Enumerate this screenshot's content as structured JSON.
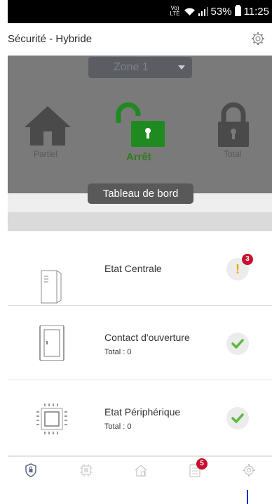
{
  "status_bar": {
    "network": "VoLTE",
    "battery": "53%",
    "time": "11:25",
    "icons": [
      "volte-icon",
      "wifi-icon",
      "signal-icon",
      "battery-icon"
    ]
  },
  "header": {
    "title": "Sécurité - Hybride",
    "settings_icon": "gear-icon"
  },
  "panel": {
    "zone": "Zone 1",
    "modes": [
      {
        "label": "Partiel",
        "icon": "house-icon",
        "active": false
      },
      {
        "label": "Arrêt",
        "icon": "unlocked-padlock-icon",
        "active": true
      },
      {
        "label": "Total",
        "icon": "locked-padlock-icon",
        "active": false
      }
    ]
  },
  "section_title": "Tableau de bord",
  "dashboard": [
    {
      "title": "Etat Centrale",
      "subtitle": "",
      "icon": "central-unit-icon",
      "status": "warning",
      "badge": "3"
    },
    {
      "title": "Contact d'ouverture",
      "subtitle": "Total : 0",
      "icon": "door-contact-icon",
      "status": "ok",
      "badge": ""
    },
    {
      "title": "Etat Périphérique",
      "subtitle": "Total : 0",
      "icon": "chip-icon",
      "status": "ok",
      "badge": ""
    }
  ],
  "bottom_nav": {
    "items": [
      {
        "name": "security-tab-icon",
        "active": true
      },
      {
        "name": "devices-tab-icon",
        "active": false
      },
      {
        "name": "home-automation-tab-icon",
        "active": false
      },
      {
        "name": "events-tab-icon",
        "active": false,
        "badge": "5"
      },
      {
        "name": "settings-tab-icon",
        "active": false
      }
    ]
  },
  "colors": {
    "active_green": "#2e7d1a",
    "icon_green": "#1f8a1f",
    "warning": "#f0a500",
    "badge_red": "#c8102e",
    "panel_overlay": "#7a7a7a"
  }
}
